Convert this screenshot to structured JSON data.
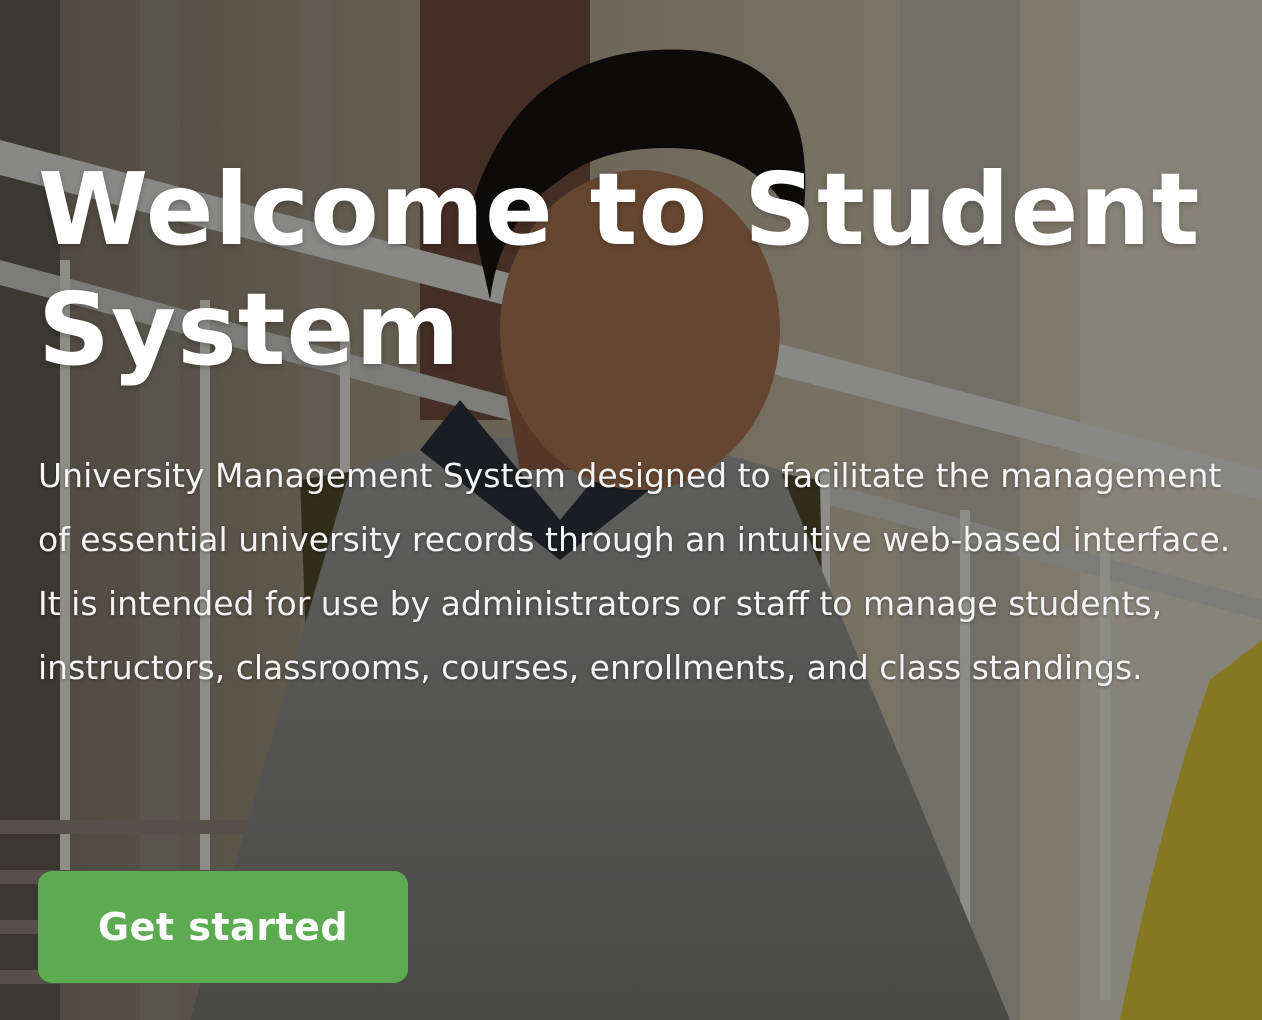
{
  "hero": {
    "title": "Welcome to Student System",
    "description": "University Management System designed to facilitate the management of essential university records through an intuitive web-based interface. It is intended for use by administrators or staff to manage students, instructors, classrooms, courses, enrollments, and class standings.",
    "cta_label": "Get started",
    "background_image": "student-walking-on-campus-photo"
  },
  "colors": {
    "accent": "#5cab50",
    "text": "#ffffff"
  }
}
